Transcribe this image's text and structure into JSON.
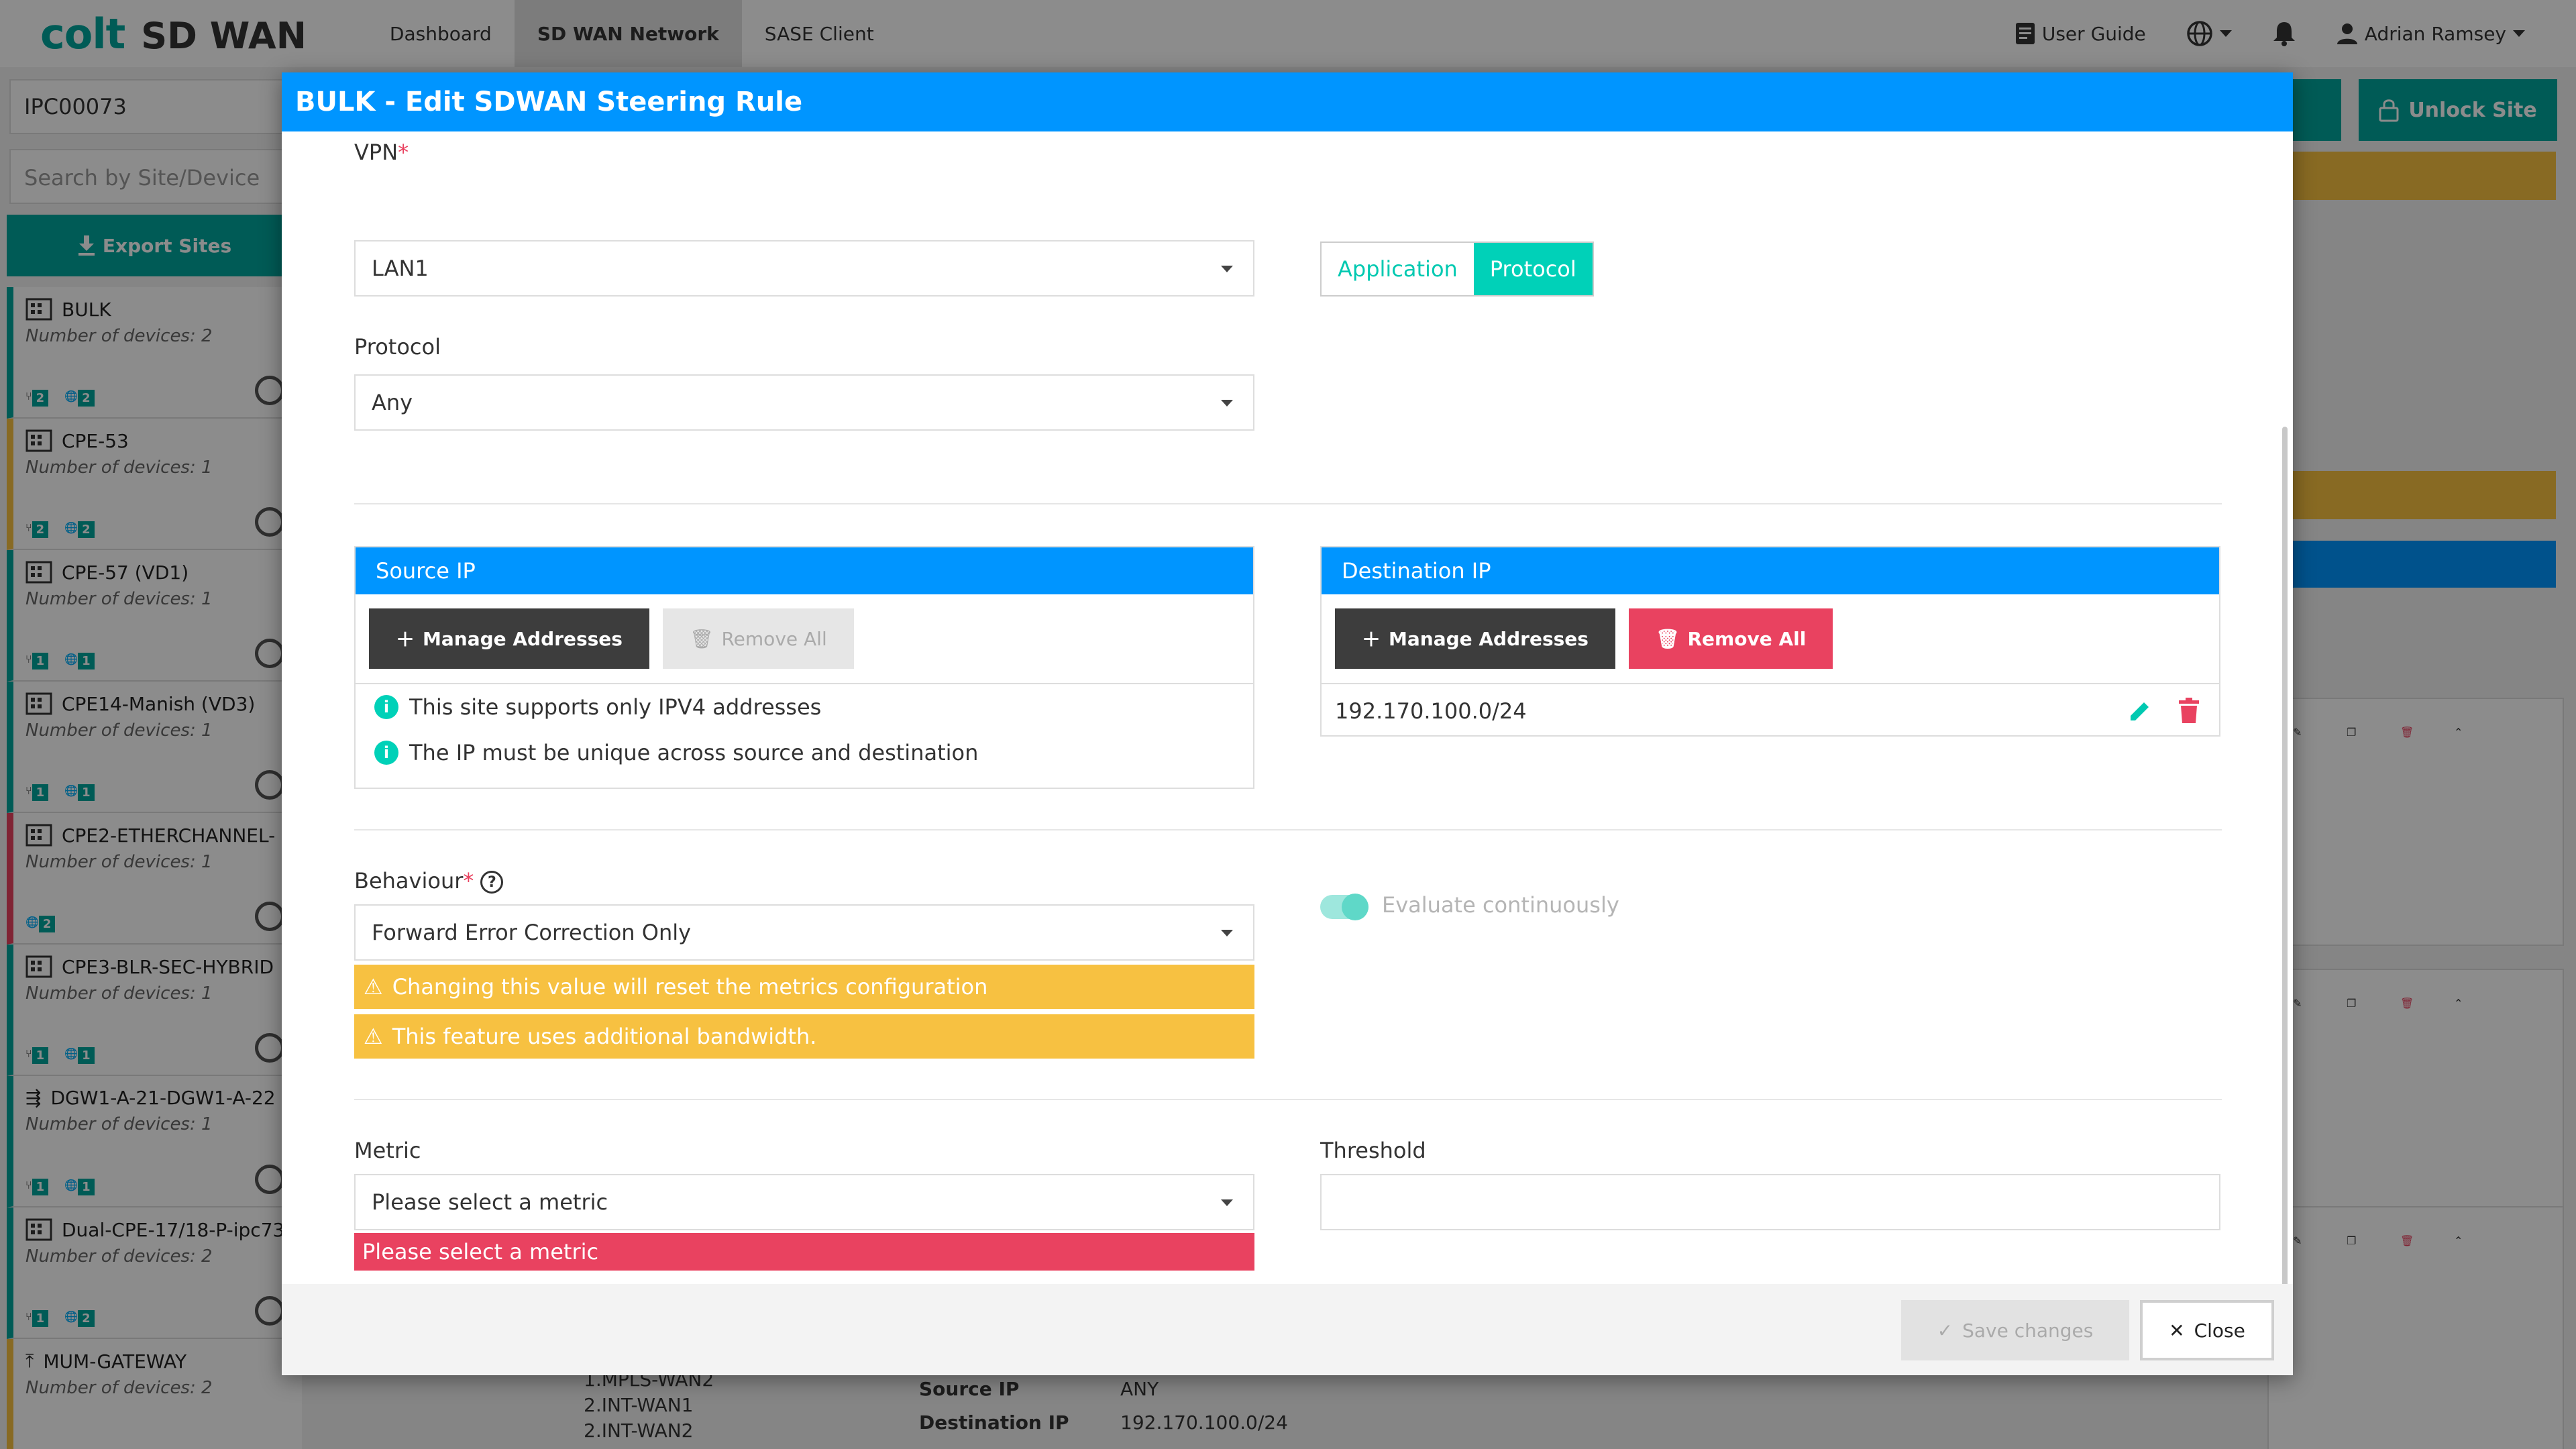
{
  "navbar": {
    "brand_colt": "colt",
    "brand_sdwan": "SD WAN",
    "links": [
      "Dashboard",
      "SD WAN Network",
      "SASE Client"
    ],
    "user_guide": "User Guide",
    "user_name": "Adrian Ramsey"
  },
  "sidebar": {
    "site_value": "IPC00073",
    "search_placeholder": "Search by Site/Device",
    "export_label": "Export Sites",
    "sites": [
      {
        "name": "BULK",
        "devices": "Number of devices: 2",
        "b1": "2",
        "b2": "2"
      },
      {
        "name": "CPE-53",
        "devices": "Number of devices: 1",
        "b1": "2",
        "b2": "2"
      },
      {
        "name": "CPE-57 (VD1)",
        "devices": "Number of devices: 1",
        "b1": "1",
        "b2": "1"
      },
      {
        "name": "CPE14-Manish (VD3)",
        "devices": "Number of devices: 1",
        "b1": "1",
        "b2": "1"
      },
      {
        "name": "CPE2-ETHERCHANNEL-",
        "devices": "Number of devices: 1",
        "b1": "",
        "b2": "2"
      },
      {
        "name": "CPE3-BLR-SEC-HYBRID",
        "devices": "Number of devices: 1",
        "b1": "1",
        "b2": "1"
      },
      {
        "name": "DGW1-A-21-DGW1-A-22",
        "devices": "Number of devices: 1",
        "b1": "1",
        "b2": "1"
      },
      {
        "name": "Dual-CPE-17/18-P-ipc73",
        "devices": "Number of devices: 2",
        "b1": "1",
        "b2": "2"
      },
      {
        "name": "MUM-GATEWAY",
        "devices": "Number of devices: 2",
        "b1": "",
        "b2": ""
      }
    ]
  },
  "background": {
    "unlock_label": "Unlock Site",
    "bottom_left": [
      "1.MPLS-WAN2",
      "2.INT-WAN1",
      "2.INT-WAN2"
    ],
    "source_ip_label": "Source IP",
    "source_ip_value": "ANY",
    "dest_ip_label": "Destination IP",
    "dest_ip_value": "192.170.100.0/24"
  },
  "modal": {
    "title": "BULK - Edit SDWAN Steering Rule",
    "vpn_label": "VPN",
    "vpn_value": "LAN1",
    "toggle_application": "Application",
    "toggle_protocol": "Protocol",
    "protocol_label": "Protocol",
    "protocol_value": "Any",
    "source_ip": {
      "title": "Source IP",
      "manage_label": "Manage Addresses",
      "remove_label": "Remove All",
      "info": [
        "This site supports only IPV4 addresses",
        "The IP must be unique across source and destination"
      ]
    },
    "dest_ip": {
      "title": "Destination IP",
      "manage_label": "Manage Addresses",
      "remove_label": "Remove All",
      "address": "192.170.100.0/24"
    },
    "behaviour_label": "Behaviour",
    "behaviour_value": "Forward Error Correction Only",
    "warning_reset": "Changing this value will reset the metrics configuration",
    "warning_bandwidth": "This feature uses additional bandwidth.",
    "evaluate_label": "Evaluate continuously",
    "metric_label": "Metric",
    "metric_value": "Please select a metric",
    "metric_error": "Please select a metric",
    "threshold_label": "Threshold",
    "save_label": "Save changes",
    "close_label": "Close"
  },
  "colors": {
    "brand_teal": "#00a79d",
    "header_blue": "#0095ff",
    "accent_teal": "#00d1b8",
    "warning_yellow": "#f7c141",
    "danger_pink": "#e94260"
  }
}
